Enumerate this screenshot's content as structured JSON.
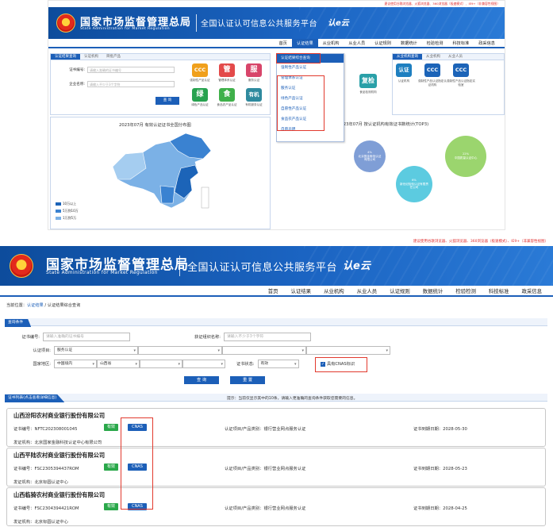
{
  "header": {
    "notice": "建议使用谷歌浏览器、火狐浏览器、360浏览器（极速模式）、IE9+（非兼容性视图）",
    "org_cn": "国家市场监督管理总局",
    "org_en": "State Administration for Market Regulation",
    "platform": "全国认证认可信息公共服务平台",
    "logo_mark": "认e云"
  },
  "nav": [
    "首页",
    "认证结果",
    "从业机构",
    "从业人员",
    "认证规则",
    "数据统计",
    "检验检测",
    "科技标准",
    "政采信息"
  ],
  "nav_active": 1,
  "shot1": {
    "left_tabs": [
      "认证结果查询",
      "认证机构",
      "目批产品"
    ],
    "cert_label": "证书编号:",
    "cert_placeholder": "请输入准确的证书编号",
    "company_label": "企业名称:",
    "company_placeholder": "请输入不少于3个字符",
    "query": "查 询",
    "tiles": [
      {
        "glyph": "CCC",
        "color": "#f0a01c",
        "caption": "强制性产品认证"
      },
      {
        "glyph": "管",
        "color": "#e34a4a",
        "caption": "管理体系认证"
      },
      {
        "glyph": "服",
        "color": "#d8456a",
        "caption": "服务认证"
      },
      {
        "glyph": "绿",
        "color": "#27a24f",
        "caption": "绿色产品认证"
      },
      {
        "glyph": "食",
        "color": "#3fb04a",
        "caption": "食品农产品认证"
      },
      {
        "glyph": "有机",
        "color": "#2f8a9e",
        "caption": "有机服务认证"
      }
    ],
    "map_title": "2023年07月 有效认证证书全国分布图",
    "legend": [
      {
        "label": "10万以上",
        "color": "#1c64b8"
      },
      {
        "label": "5万到10万",
        "color": "#3a82d1"
      },
      {
        "label": "1万到5万",
        "color": "#7bb1e6"
      }
    ],
    "dropdown": [
      "认证结果综合查询",
      "强制性产品认证",
      "管理体系认证",
      "服务认证",
      "绿色产品认证",
      "自愿性产品认证",
      "食品农产品认证",
      "自愿声明"
    ],
    "right_tabs": [
      "从业机构查询",
      "从业机构",
      "从业人员"
    ],
    "right_tiles": [
      {
        "glyph": "复检",
        "color": "#2aa0a8",
        "caption": "食品检测机构"
      },
      {
        "glyph": "认证",
        "color": "#1e7fc0",
        "caption": "认证机构"
      },
      {
        "glyph": "CCC",
        "color": "#1c64b8",
        "caption": "强制性产品认证指定认证机构"
      },
      {
        "glyph": "CCC",
        "color": "#1c64b8",
        "caption": "强制性产品认证指定实验室"
      }
    ],
    "stats_title": "2023年07月 按认证机构有效证书数统计(TOP3)",
    "bubbles": [
      {
        "label": "4%\n北京国金衡信认证有限公司",
        "color": "#7f9ed6"
      },
      {
        "label": "6%\n新世纪检验认证有限责任公司",
        "color": "#5ccbe0"
      },
      {
        "label": "22%\n中国质量认证中心",
        "color": "#9bd56e"
      }
    ]
  },
  "shot2": {
    "breadcrumb_prefix": "当前位置：",
    "breadcrumb_link": "认证结果",
    "breadcrumb_current": "认证结果综合查询",
    "conditions_title": "查询条件",
    "cert_no_label": "证书编号:",
    "cert_no_placeholder": "请输入准确的证书编号",
    "org_label": "获证组织名称:",
    "org_placeholder": "请输入不少于3个字符",
    "project_label": "认证项目:",
    "project_value": "服务认证",
    "region_label": "国家地区:",
    "region_country": "中国境内",
    "region_province": "山西省",
    "status_label": "证书状态:",
    "status_value": "有效",
    "cnas_label": "具有CNAS标识",
    "btn_query": "查 询",
    "btn_reset": "重 置",
    "list_title": "证书列表(点击查看详细信息)",
    "hint": "提示：当前仅显示其中的10条，请输入更准确的查询条件获取您需要的信息。",
    "records": [
      {
        "company": "山西汾阳农村商业银行股份有限公司",
        "cert_no": "证书编号：NFTC202308001045",
        "status": "有效",
        "cnas": "CNAS",
        "issuer": "发证机构：北京国家金融科技认证中心有限公司",
        "project": "认证项目/产品类别：银行营业网点服务认证",
        "expiry": "证书到期日期：2028-05-30"
      },
      {
        "company": "山西平陆农村商业银行股份有限公司",
        "cert_no": "证书编号：FSC2305394437ROM",
        "status": "有效",
        "cnas": "CNAS",
        "issuer": "发证机构：北京标圆认证中心",
        "project": "认证项目/产品类别：银行营业网点服务认证",
        "expiry": "证书到期日期：2028-05-23"
      },
      {
        "company": "山西临猗农村商业银行股份有限公司",
        "cert_no": "证书编号：FSC2304394421ROM",
        "status": "有效",
        "cnas": "CNAS",
        "issuer": "发证机构：北京标圆认证中心",
        "project": "认证项目/产品类别：银行营业网点服务认证",
        "expiry": "证书到期日期：2028-04-25"
      }
    ]
  }
}
